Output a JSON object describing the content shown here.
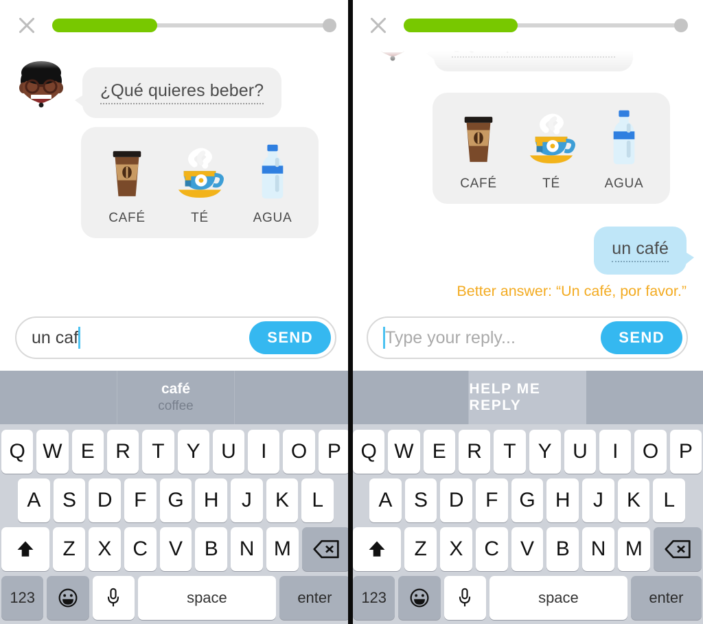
{
  "colors": {
    "progress_fill": "#78c800",
    "progress_track": "#d4d4d4",
    "send_blue": "#35b8f0",
    "user_bubble": "#bfe6f8",
    "bot_bubble": "#f0f0f0",
    "hint_orange": "#f3ab21",
    "keyboard_bg": "#ced2d9",
    "suggest_bar": "#a6aeba",
    "divider": "#0a0a0a"
  },
  "panels": [
    {
      "id": "left",
      "header": {
        "close_icon": "close-x-icon",
        "progress_percent": 37,
        "progress_knob_icon": "progress-knob-icon"
      },
      "chat": {
        "avatar_icon": "bot-avatar-icon",
        "bot_message": "¿Qué quieres beber?",
        "choices": [
          {
            "label": "CAFÉ",
            "icon": "coffee-cup-icon"
          },
          {
            "label": "TÉ",
            "icon": "tea-cup-icon"
          },
          {
            "label": "AGUA",
            "icon": "water-bottle-icon"
          }
        ]
      },
      "input": {
        "value": "un caf",
        "placeholder": "",
        "send_label": "SEND",
        "caret_visible": true
      },
      "suggestions": {
        "cells": [
          {
            "word": "",
            "translation": "",
            "highlight": false
          },
          {
            "word": "café",
            "translation": "coffee",
            "highlight": false
          },
          {
            "word": "",
            "translation": "",
            "highlight": false
          }
        ],
        "action_label": ""
      }
    },
    {
      "id": "right",
      "header": {
        "close_icon": "close-x-icon",
        "progress_percent": 40,
        "progress_knob_icon": "progress-knob-icon"
      },
      "chat": {
        "avatar_icon": "bot-avatar-icon",
        "bot_message": "¿Qué quieres beber?",
        "choices": [
          {
            "label": "CAFÉ",
            "icon": "coffee-cup-icon"
          },
          {
            "label": "TÉ",
            "icon": "tea-cup-icon"
          },
          {
            "label": "AGUA",
            "icon": "water-bottle-icon"
          }
        ],
        "user_message": "un café",
        "better_answer": "Better answer: “Un café, por favor.”"
      },
      "input": {
        "value": "",
        "placeholder": "Type your reply...",
        "send_label": "SEND",
        "caret_visible": true
      },
      "suggestions": {
        "cells": [
          {
            "word": "",
            "translation": "",
            "highlight": false
          },
          {
            "word": "",
            "translation": "",
            "highlight": true
          },
          {
            "word": "",
            "translation": "",
            "highlight": false
          }
        ],
        "action_label": "HELP ME REPLY"
      }
    }
  ],
  "keyboard": {
    "row1": [
      "Q",
      "W",
      "E",
      "R",
      "T",
      "Y",
      "U",
      "I",
      "O",
      "P"
    ],
    "row2": [
      "A",
      "S",
      "D",
      "F",
      "G",
      "H",
      "J",
      "K",
      "L"
    ],
    "row3": [
      "Z",
      "X",
      "C",
      "V",
      "B",
      "N",
      "M"
    ],
    "shift_icon": "shift-arrow-icon",
    "backspace_icon": "backspace-delete-icon",
    "numeric_label": "123",
    "emoji_icon": "emoji-smiley-icon",
    "mic_icon": "microphone-icon",
    "space_label": "space",
    "enter_label": "enter"
  }
}
